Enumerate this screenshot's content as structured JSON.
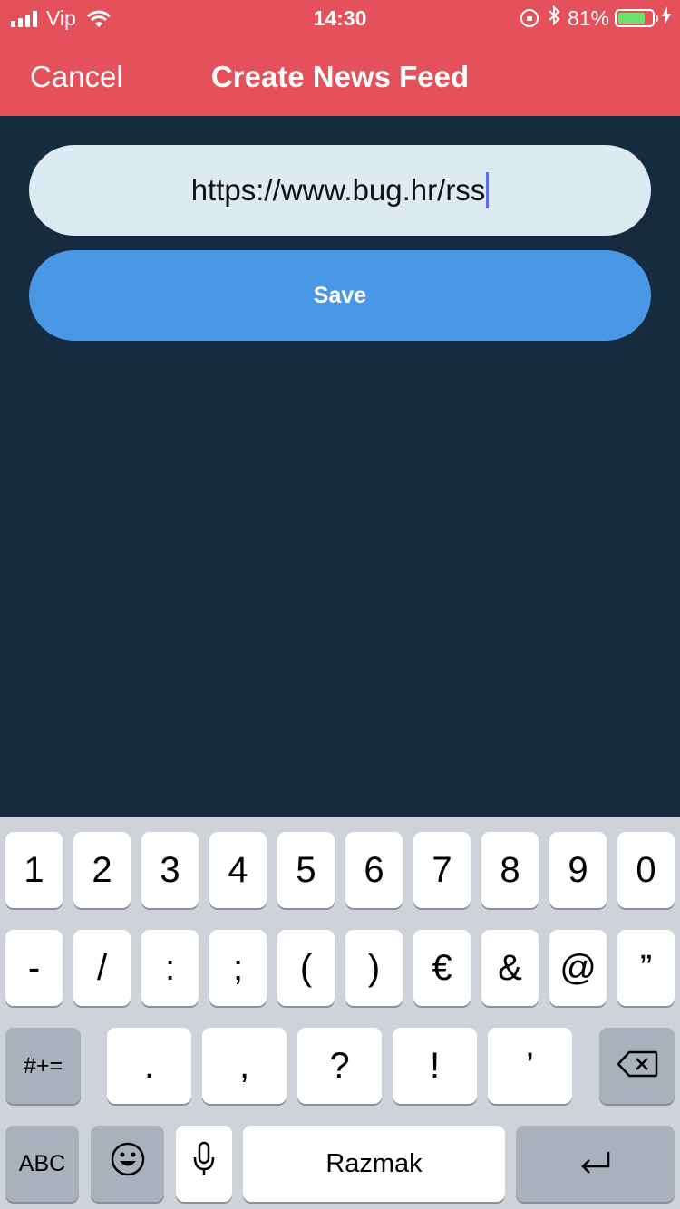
{
  "status_bar": {
    "carrier": "Vip",
    "time": "14:30",
    "battery_percent": "81%",
    "battery_level": 0.81,
    "icons": [
      "signal-icon",
      "wifi-icon",
      "rotation-lock-icon",
      "bluetooth-icon",
      "battery-icon",
      "charging-icon"
    ]
  },
  "nav": {
    "cancel_label": "Cancel",
    "title": "Create News Feed"
  },
  "form": {
    "url_value": "https://www.bug.hr/rss",
    "save_label": "Save"
  },
  "keyboard": {
    "row1": [
      "1",
      "2",
      "3",
      "4",
      "5",
      "6",
      "7",
      "8",
      "9",
      "0"
    ],
    "row2": [
      "-",
      "/",
      ":",
      ";",
      "(",
      ")",
      "€",
      "&",
      "@",
      "”"
    ],
    "row3": [
      ".",
      ",",
      "?",
      "!",
      "’"
    ],
    "symbols_label": "#+=",
    "abc_label": "ABC",
    "space_label": "Razmak"
  },
  "colors": {
    "header": "#e5515a",
    "background": "#162b40",
    "input": "#ddeaf2",
    "save_button": "#4a97e5",
    "keyboard": "#ced3da"
  }
}
